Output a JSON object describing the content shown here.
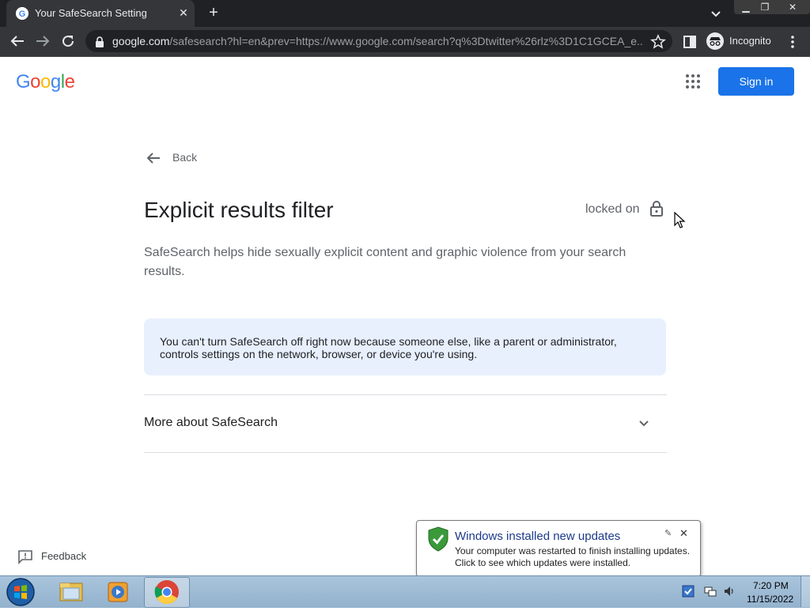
{
  "browser": {
    "tab_title": "Your SafeSearch Setting",
    "url_host": "google.com",
    "url_rest": "/safesearch?hl=en&prev=https://www.google.com/search?q%3Dtwitter%26rlz%3D1C1GCEA_e...",
    "profile_label": "Incognito"
  },
  "page": {
    "logo": [
      "G",
      "o",
      "o",
      "g",
      "l",
      "e"
    ],
    "signin_label": "Sign in",
    "back_label": "Back",
    "heading": "Explicit results filter",
    "status_label": "locked on",
    "description": "SafeSearch helps hide sexually explicit content and graphic violence from your search results.",
    "notice": "You can't turn SafeSearch off right now because someone else, like a parent or administrator, controls settings on the network, browser, or device you're using.",
    "more_label": "More about SafeSearch",
    "feedback_label": "Feedback"
  },
  "notification": {
    "title": "Windows installed new updates",
    "body": "Your computer was restarted to finish installing updates. Click to see which updates were installed."
  },
  "taskbar": {
    "time": "7:20 PM",
    "date": "11/15/2022"
  },
  "colors": {
    "accent": "#1a73e8",
    "notice_bg": "#e8f0fe",
    "logo": [
      "#4285f4",
      "#ea4335",
      "#fbbc05",
      "#4285f4",
      "#34a853",
      "#ea4335"
    ]
  }
}
